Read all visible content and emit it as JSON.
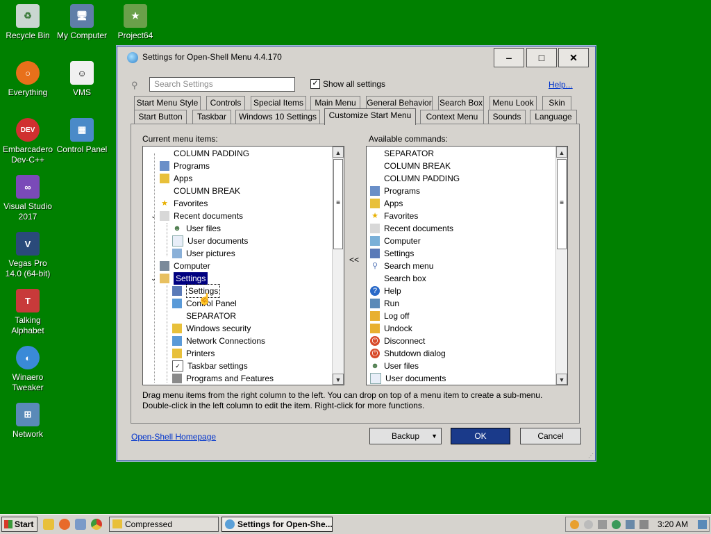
{
  "desktop": {
    "icons": [
      {
        "label": "Recycle Bin",
        "icon": "recycle-bin-icon"
      },
      {
        "label": "My Computer",
        "icon": "computer-icon"
      },
      {
        "label": "Project64",
        "icon": "project64-icon"
      },
      {
        "label": "Everything",
        "icon": "everything-icon"
      },
      {
        "label": "VMS",
        "icon": "vms-icon"
      },
      {
        "label": "Embarcadero Dev-C++",
        "icon": "devcpp-icon"
      },
      {
        "label": "Control Panel",
        "icon": "control-panel-icon"
      },
      {
        "label": "Visual Studio 2017",
        "icon": "visual-studio-icon"
      },
      {
        "label": "Vegas Pro 14.0 (64-bit)",
        "icon": "vegas-pro-icon"
      },
      {
        "label": "Talking Alphabet",
        "icon": "talking-alphabet-icon"
      },
      {
        "label": "Winaero Tweaker",
        "icon": "winaero-icon"
      },
      {
        "label": "Network",
        "icon": "network-icon"
      }
    ]
  },
  "window": {
    "title": "Settings for Open-Shell Menu 4.4.170",
    "minimize": "‒",
    "maximize": "□",
    "close": "✕"
  },
  "toolbar": {
    "search_placeholder": "Search Settings",
    "show_all_label": "Show all settings",
    "show_all_checked": true,
    "help_link": "Help..."
  },
  "tabs": {
    "row1": [
      "Start Menu Style",
      "Controls",
      "Special Items",
      "Main Menu",
      "General Behavior",
      "Search Box",
      "Menu Look",
      "Skin"
    ],
    "row2": [
      "Start Button",
      "Taskbar",
      "Windows 10 Settings",
      "Customize Start Menu",
      "Context Menu",
      "Sounds",
      "Language"
    ],
    "active": "Customize Start Menu"
  },
  "current_menu": {
    "label": "Current menu items:",
    "items": [
      "COLUMN PADDING",
      "Programs",
      "Apps",
      "COLUMN BREAK",
      "Favorites",
      "Recent documents",
      "User files",
      "User documents",
      "User pictures",
      "Computer",
      "Settings",
      "Settings",
      "Control Panel",
      "SEPARATOR",
      "Windows security",
      "Network Connections",
      "Printers",
      "Taskbar settings",
      "Programs and Features"
    ]
  },
  "move_button": "<<",
  "available": {
    "label": "Available commands:",
    "items": [
      "SEPARATOR",
      "COLUMN BREAK",
      "COLUMN PADDING",
      "Programs",
      "Apps",
      "Favorites",
      "Recent documents",
      "Computer",
      "Settings",
      "Search menu",
      "Search box",
      "Help",
      "Run",
      "Log off",
      "Undock",
      "Disconnect",
      "Shutdown dialog",
      "User files",
      "User documents"
    ]
  },
  "hint": {
    "line1": "Drag menu items from the right column to the left. You can drop on top of a menu item to create a sub-menu.",
    "line2": "Double-click in the left column to edit the item. Right-click for more functions."
  },
  "footer": {
    "homepage": "Open-Shell Homepage",
    "backup": "Backup",
    "ok": "OK",
    "cancel": "Cancel"
  },
  "taskbar": {
    "start": "Start",
    "tasks": [
      "Compressed",
      "Settings for Open-She..."
    ],
    "clock": "3:20 AM"
  },
  "colors": {
    "desktop": "#008000",
    "selection": "#000080",
    "ok_button": "#1a3a8a"
  }
}
